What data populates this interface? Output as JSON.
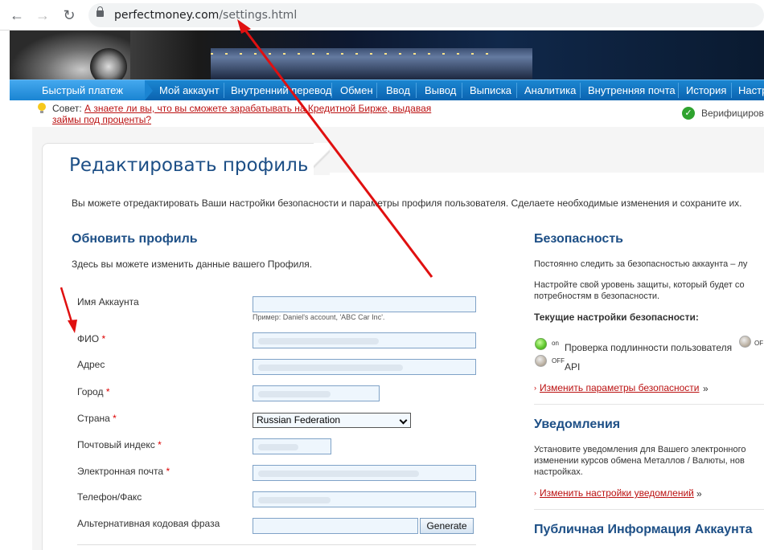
{
  "browser": {
    "back_glyph": "←",
    "forward_glyph": "→",
    "reload_glyph": "↻",
    "url_host": "perfectmoney.com",
    "url_path": "/settings.html"
  },
  "menu": {
    "quick_pay": "Быстрый платеж",
    "items": [
      "Мой аккаунт",
      "Внутренний перевод",
      "Обмен",
      "Ввод",
      "Вывод",
      "Выписка",
      "Аналитика",
      "Внутренняя почта",
      "История",
      "Настр"
    ]
  },
  "tip": {
    "label": "Совет:",
    "link_line1": "А знаете ли вы, что вы сможете зарабатывать на Кредитной Бирже, выдавая",
    "link_line2": "займы под проценты?",
    "verified": "Верифицирова"
  },
  "page": {
    "title": "Редактировать профиль",
    "intro": "Вы можете отредактировать Ваши настройки безопасности и параметры профиля пользователя. Сделаете необходимые изменения и сохраните их."
  },
  "profile": {
    "heading": "Обновить профиль",
    "description": "Здесь вы можете изменить данные вашего Профиля.",
    "account_name_label": "Имя Аккаунта",
    "account_name_hint": "Пример: Daniel's account, 'ABC Car Inc'.",
    "fio_label": "ФИО",
    "address_label": "Адрес",
    "city_label": "Город",
    "country_label": "Страна",
    "country_value": "Russian Federation",
    "zip_label": "Почтовый индекс",
    "email_label": "Электронная почта",
    "phone_label": "Телефон/Факс",
    "alt_phrase_label": "Альтернативная кодовая фраза",
    "generate_button": "Generate",
    "required_mark": "*"
  },
  "security": {
    "heading": "Безопасность",
    "line1": "Постоянно следить за безопасностью аккаунта – лу",
    "line2": "Настройте свой уровень защиты, который будет со",
    "line3": "потребностям в безопасности.",
    "current_settings": "Текущие настройки безопасности:",
    "auth_state": "on",
    "auth_label": "Проверка подлинности пользователя",
    "extra_state": "OF",
    "api_state": "OFF",
    "api_label": "API",
    "change_link": "Изменить параметры безопасности",
    "link_tail": "»"
  },
  "notifications": {
    "heading": "Уведомления",
    "line1": "Установите уведомления для Вашего электронного",
    "line2": "изменении курсов обмена Металлов / Валюты, нов",
    "line3": "настройках.",
    "change_link": "Изменить настройки уведомлений",
    "link_tail": "»"
  },
  "public_info": {
    "heading": "Публичная Информация Аккаунта"
  },
  "colors": {
    "menu_blue": "#0b63b0",
    "heading_blue": "#1d4f86",
    "link_red": "#bb1111",
    "arrow_red": "#e01010"
  }
}
